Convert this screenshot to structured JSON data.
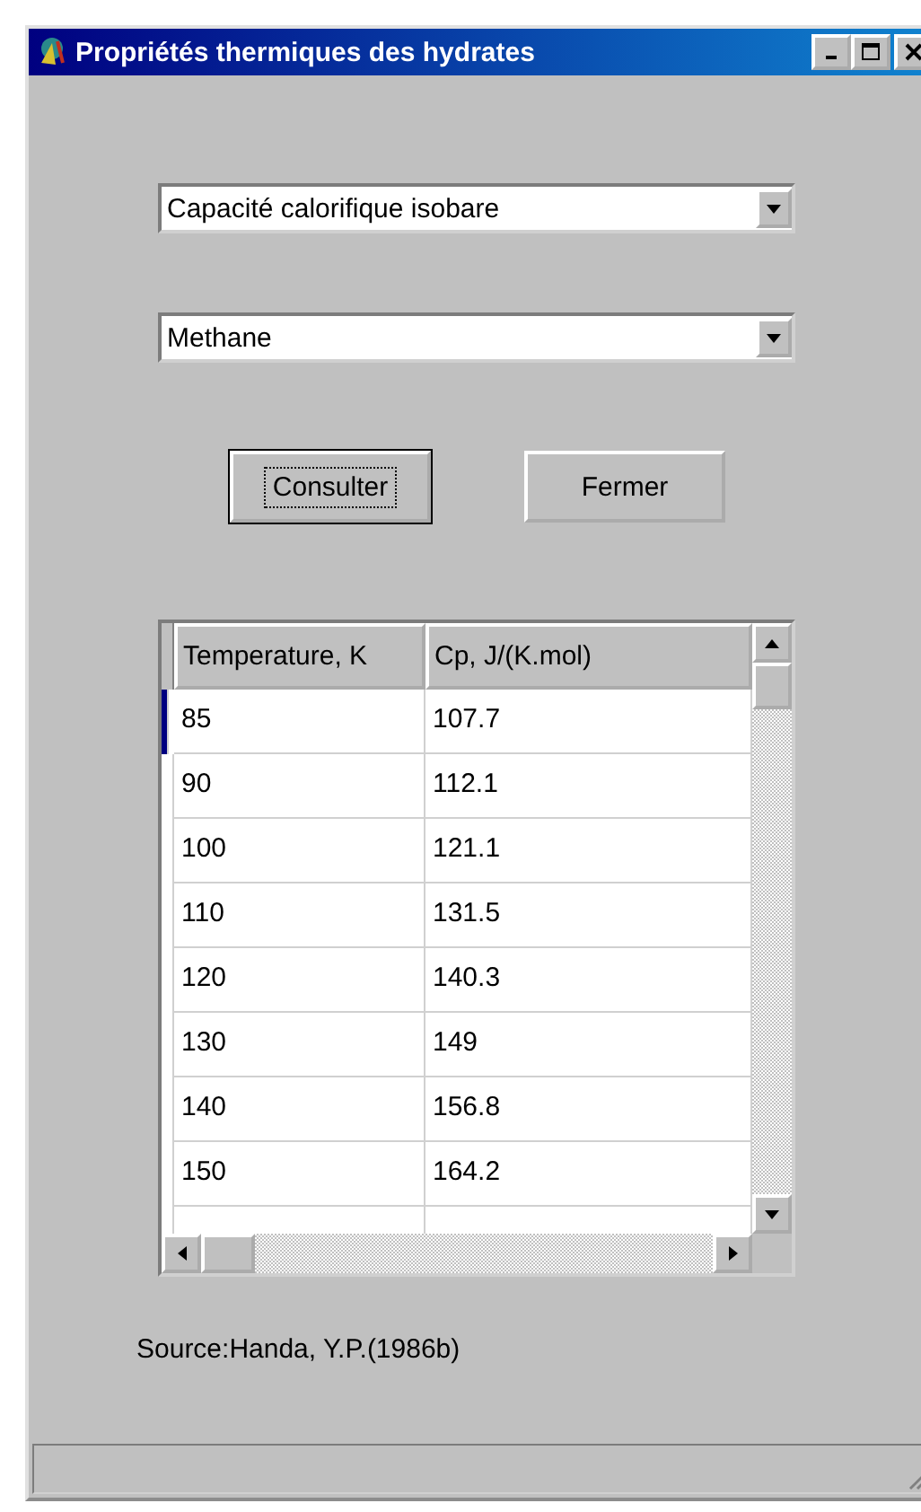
{
  "window": {
    "title": "Propriétés thermiques des hydrates"
  },
  "dropdowns": [
    {
      "value": "Capacité calorifique isobare"
    },
    {
      "value": "Methane"
    }
  ],
  "buttons": [
    {
      "label": "Consulter",
      "default": true
    },
    {
      "label": "Fermer",
      "default": false
    }
  ],
  "table": {
    "columns": [
      "Temperature, K",
      "Cp, J/(K.mol)"
    ],
    "rows": [
      {
        "cells": [
          "85",
          "107.7"
        ],
        "selected": true
      },
      {
        "cells": [
          "90",
          "112.1"
        ],
        "selected": false
      },
      {
        "cells": [
          "100",
          "121.1"
        ],
        "selected": false
      },
      {
        "cells": [
          "110",
          "131.5"
        ],
        "selected": false
      },
      {
        "cells": [
          "120",
          "140.3"
        ],
        "selected": false
      },
      {
        "cells": [
          "130",
          "149"
        ],
        "selected": false
      },
      {
        "cells": [
          "140",
          "156.8"
        ],
        "selected": false
      },
      {
        "cells": [
          "150",
          "164.2"
        ],
        "selected": false
      }
    ]
  },
  "source": "Source:Handa, Y.P.(1986b)"
}
